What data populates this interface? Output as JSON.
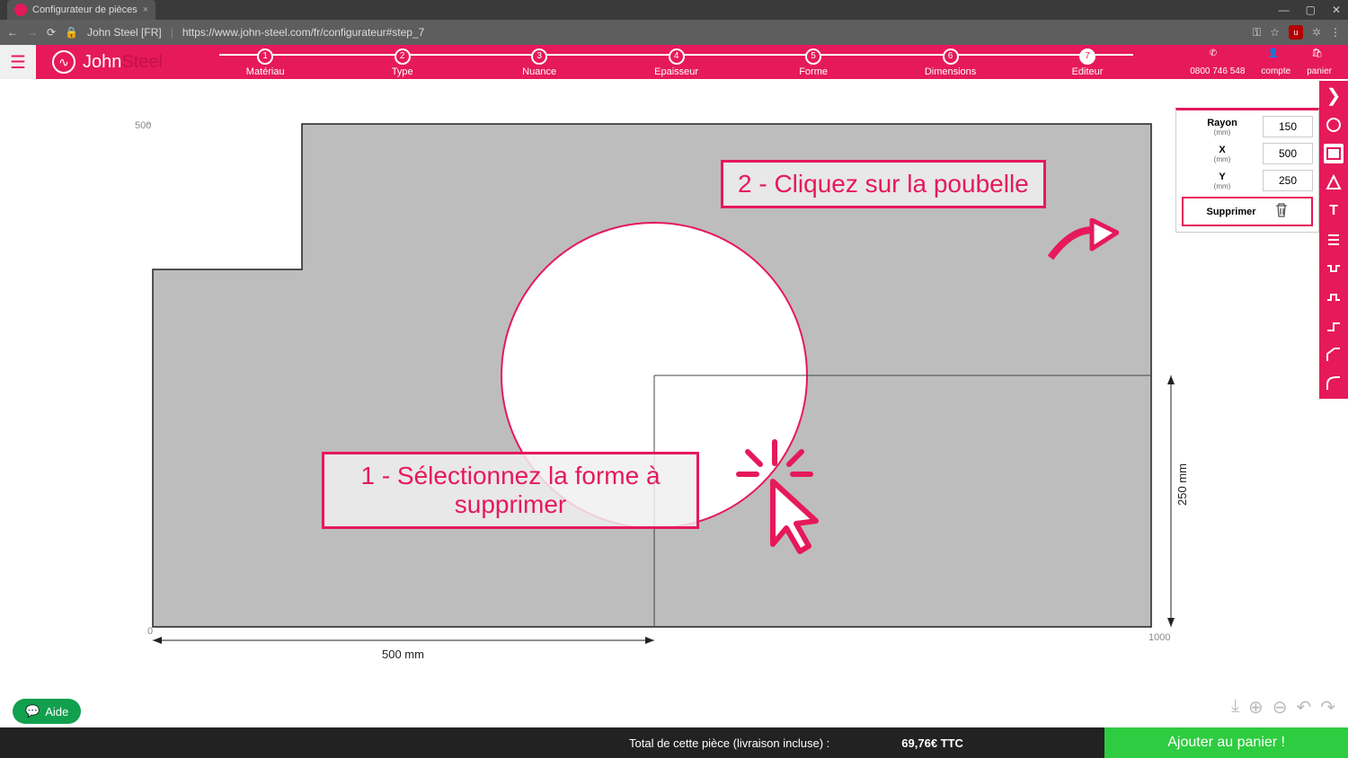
{
  "browser": {
    "tab_title": "Configurateur de pièces",
    "url_prefix": "John Steel [FR]",
    "url": "https://www.john-steel.com/fr/configurateur#step_7"
  },
  "window_controls": {
    "min": "—",
    "max": "▢",
    "close": "✕"
  },
  "logo": {
    "john": "John",
    "steel": "Steel"
  },
  "steps": [
    {
      "num": "1",
      "label": "Matériau"
    },
    {
      "num": "2",
      "label": "Type"
    },
    {
      "num": "3",
      "label": "Nuance"
    },
    {
      "num": "4",
      "label": "Epaisseur"
    },
    {
      "num": "5",
      "label": "Forme"
    },
    {
      "num": "6",
      "label": "Dimensions"
    },
    {
      "num": "7",
      "label": "Editeur"
    }
  ],
  "header_right": {
    "phone": "0800 746 548",
    "account": "compte",
    "cart": "panier"
  },
  "properties": {
    "radius_label": "Rayon",
    "x_label": "X",
    "y_label": "Y",
    "unit": "(mm)",
    "radius_value": "150",
    "x_value": "500",
    "y_value": "250",
    "delete_label": "Supprimer"
  },
  "ruler": {
    "left_label": "500",
    "origin_label": "0",
    "right_label": "1000",
    "h_dim": "500 mm",
    "v_dim": "250 mm"
  },
  "annotations": {
    "step1": "1 - Sélectionnez la forme à supprimer",
    "step2": "2 - Cliquez sur la poubelle"
  },
  "footer": {
    "help": "Aide",
    "total_label": "Total de cette pièce (livraison incluse) :",
    "price": "69,76€ TTC",
    "add_to_cart": "Ajouter au panier !"
  }
}
